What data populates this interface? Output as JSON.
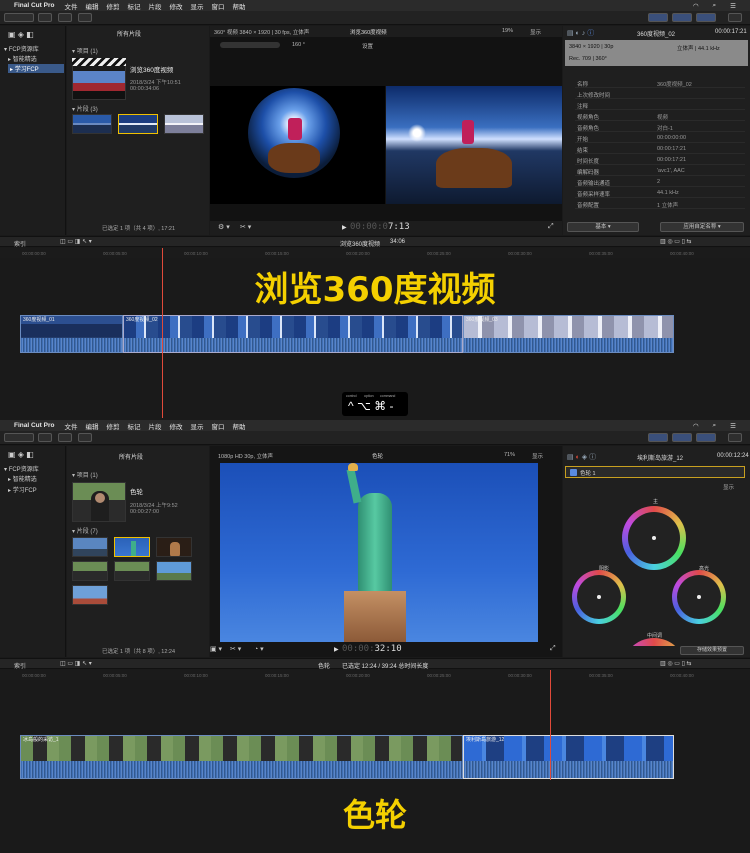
{
  "menu": {
    "app_name": "Final Cut Pro",
    "items": [
      "文件",
      "编辑",
      "修剪",
      "标记",
      "片段",
      "修改",
      "显示",
      "窗口",
      "帮助"
    ]
  },
  "top": {
    "sidebar": {
      "library": "FCP资源库",
      "items": [
        "智能精选",
        "学习FCP"
      ]
    },
    "browser": {
      "filter": "所有片段",
      "project_header": "项目",
      "project_count": "(1)",
      "project_name": "浏览360度视频",
      "project_date": "2018/3/24 下午10:51",
      "project_duration": "00:00:34:06",
      "clips_header": "片段",
      "clips_count": "(3)",
      "status": "已选定 1 项（共 4 项）, 17:21"
    },
    "viewer": {
      "format": "360° 视频 3840 × 1920 | 30 fps, 立体声",
      "angle": "160 °",
      "settings": "设置",
      "title": "浏览360度视频",
      "zoom": "19%",
      "display": "显示",
      "timecode_dim": "00:00:0",
      "timecode_main": "7:13"
    },
    "inspector": {
      "clip_name": "360度视频_02",
      "clip_time": "00:00:17:21",
      "res": "3840 × 1920 | 30p",
      "audio": "立体声 | 44.1 kHz",
      "colorspace": "Rec. 709 | 360°",
      "rows": [
        {
          "k": "名称",
          "v": "360度视频_02"
        },
        {
          "k": "上次修改时间",
          "v": ""
        },
        {
          "k": "注释",
          "v": ""
        },
        {
          "k": "视频角色",
          "v": "视频"
        },
        {
          "k": "音频角色",
          "v": "对白-1"
        },
        {
          "k": "开始",
          "v": "00:00:00:00"
        },
        {
          "k": "结束",
          "v": "00:00:17:21"
        },
        {
          "k": "时间长度",
          "v": "00:00:17:21"
        },
        {
          "k": "编解码器",
          "v": "'avc1', AAC"
        },
        {
          "k": "音频输出通道",
          "v": "2"
        },
        {
          "k": "音频采样速率",
          "v": "44.1 kHz"
        },
        {
          "k": "音频配置",
          "v": "1 立体声"
        }
      ],
      "basic": "基本",
      "apply_custom": "应用自定名称"
    },
    "timeline": {
      "index": "索引",
      "project": "浏览360度视频",
      "duration": "34:06",
      "ruler": [
        "00:00:00:00",
        "00:00:05:00",
        "00:00:10:00",
        "00:00:15:00",
        "00:00:20:00",
        "00:00:25:00",
        "00:00:30:00",
        "00:00:35:00",
        "00:00:40:00"
      ],
      "clips": [
        "360度视频_01",
        "360度视频_02",
        "360度视频_03"
      ]
    },
    "caption": "浏览360度视频",
    "shortcut": {
      "labels": [
        "control",
        "option",
        "command"
      ],
      "keys": "^ ⌥ ⌘ -"
    }
  },
  "bottom": {
    "sidebar": {
      "library": "FCP资源库",
      "items": [
        "智能精选",
        "学习FCP"
      ]
    },
    "browser": {
      "filter": "所有片段",
      "project_header": "项目",
      "project_count": "(1)",
      "project_name": "色轮",
      "project_date": "2018/3/24 上午9:52",
      "project_duration": "00:00:27:00",
      "clips_header": "片段",
      "clips_count": "(7)",
      "status": "已选定 1 项（共 8 项）, 12:24"
    },
    "viewer": {
      "format": "1080p HD 30p, 立体声",
      "title": "色轮",
      "zoom": "71%",
      "display": "显示",
      "timecode_dim": "00:00:",
      "timecode_main": "32:10"
    },
    "inspector": {
      "clip_name": "埃利斯岛旅游_12",
      "time": "00:00:12:24",
      "effect": "色轮 1",
      "display": "显示",
      "wheel_master": "主",
      "wheel_shadows": "阴影",
      "wheel_highlights": "高光",
      "wheel_midtones": "中间调",
      "save_preset": "存储效果预置"
    },
    "timeline": {
      "index": "索引",
      "project": "色轮",
      "selection": "已选定 12:24 / 39:24 总时间长度",
      "ruler": [
        "00:00:00:00",
        "00:00:05:00",
        "00:00:10:00",
        "00:00:15:00",
        "00:00:20:00",
        "00:00:25:00",
        "00:00:30:00",
        "00:00:35:00",
        "00:00:40:00"
      ],
      "clips": [
        "冰岛般的采访_1",
        "埃利斯岛旅游_12"
      ]
    },
    "caption": "色轮"
  },
  "colors": {
    "caption": "#f4d000",
    "playhead": "#e04a3a",
    "clip_blue": "#2d4a7a",
    "selection": "#3a5a8a"
  }
}
